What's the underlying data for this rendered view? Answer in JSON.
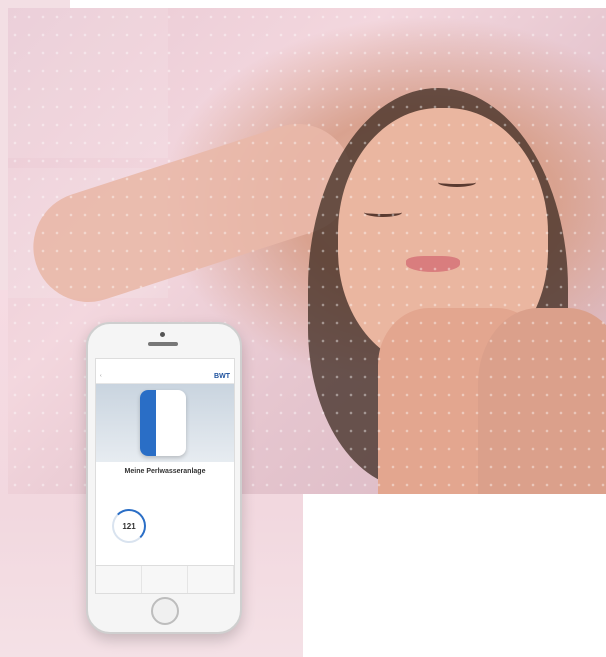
{
  "phone_app": {
    "brand": "BWT",
    "title": "Meine Perlwasseranlage",
    "gauge_value": "121"
  },
  "colors": {
    "brand_blue": "#2a6ec6",
    "pink_bg": "#f3dfe4"
  },
  "icons": {
    "back": "chevron-left-icon",
    "home": "home-button-icon"
  }
}
